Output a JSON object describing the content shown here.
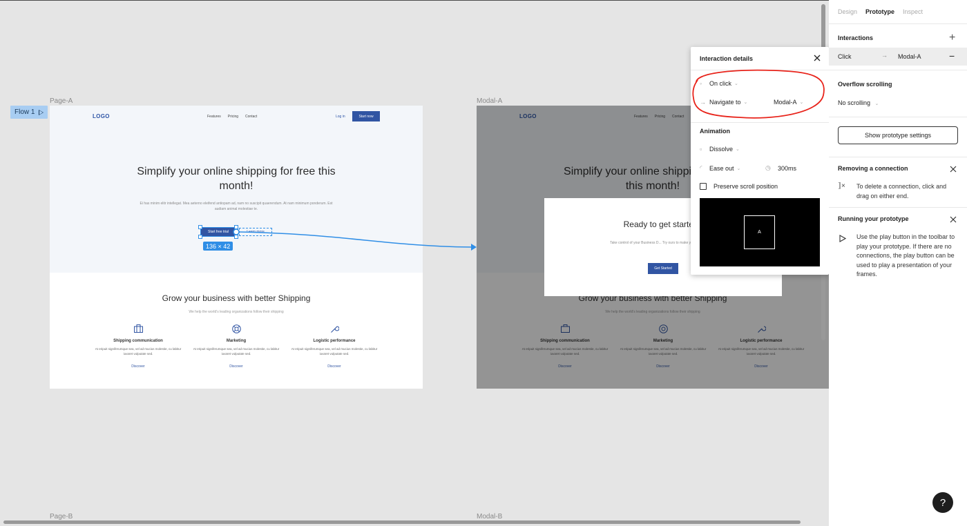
{
  "canvas": {
    "flow1_label": "Flow 1",
    "frames": {
      "page_a_label": "Page-A",
      "modal_a_label": "Modal-A",
      "page_b_label": "Page-B",
      "modal_b_label": "Modal-B"
    },
    "selection_size": "136 × 42"
  },
  "site": {
    "logo": "LOGO",
    "nav": [
      "Features",
      "Pricing",
      "Contact"
    ],
    "login": "Log in",
    "start_now": "Start now",
    "headline": "Simplify your online shipping for free this month!",
    "subtext": "Ei has minim elitr intellegat. Mea aeterno eleifend antiopam ad, nam no suscipit quaerendum. At nam minimum ponderum. Est audiam animal molestiae te.",
    "cta_primary": "Start free trial",
    "cta_secondary": "Learn more",
    "section_title": "Grow your business with better Shipping",
    "section_sub": "We help the world's leading organizations follow their shipping",
    "features": [
      {
        "title": "Shipping communication",
        "desc": "At eripuit signiferumque sea, vel ad mucius molestie, cu labitur iuvaret vulputate sed.",
        "link": "Discover",
        "icon": "briefcase-icon"
      },
      {
        "title": "Marketing",
        "desc": "At eripuit signiferumque sea, vel ad mucius molestie, cu labitur iuvaret vulputate sed.",
        "link": "Discover",
        "icon": "lifebuoy-icon"
      },
      {
        "title": "Logistic performance",
        "desc": "At eripuit signiferumque sea, vel ad mucius molestie, cu labitur iuvaret vulputate sed.",
        "link": "Discover",
        "icon": "wrench-icon"
      }
    ]
  },
  "modal": {
    "title": "Ready to get started?",
    "desc": "Take control of your Business D... Try ours to make your business b...",
    "button": "Get Started"
  },
  "popup": {
    "title": "Interaction details",
    "trigger": "On click",
    "action": "Navigate to",
    "destination": "Modal-A",
    "animation_label": "Animation",
    "animation_type": "Dissolve",
    "easing": "Ease out",
    "duration": "300ms",
    "preserve_scroll": "Preserve scroll position",
    "preview_letter": "A"
  },
  "panel": {
    "tabs": [
      "Design",
      "Prototype",
      "Inspect"
    ],
    "active_tab": "Prototype",
    "interactions_label": "Interactions",
    "interaction": {
      "trigger": "Click",
      "target": "Modal-A"
    },
    "overflow_label": "Overflow scrolling",
    "overflow_value": "No scrolling",
    "settings_button": "Show prototype settings",
    "removing_title": "Removing a connection",
    "removing_text": "To delete a connection, click and drag on either end.",
    "running_title": "Running your prototype",
    "running_text": "Use the play button in the toolbar to play your prototype. If there are no connections, the play button can be used to play a presentation of your frames.",
    "help": "?"
  },
  "colors": {
    "accent": "#2f8ee6",
    "brand": "#3155a3",
    "annotation": "#e8231a"
  }
}
